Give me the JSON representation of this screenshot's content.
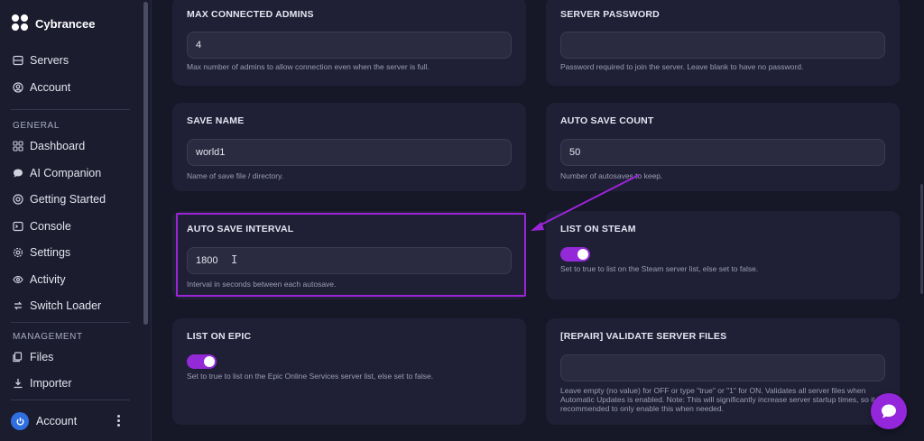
{
  "brand": {
    "name": "Cybrancee",
    "icon": "cybrancee-logo"
  },
  "sidebar": {
    "top_items": [
      {
        "label": "Servers",
        "icon": "server-icon"
      },
      {
        "label": "Account",
        "icon": "user-circle-icon"
      }
    ],
    "general_label": "GENERAL",
    "general_items": [
      {
        "label": "Dashboard",
        "icon": "grid-icon"
      },
      {
        "label": "AI Companion",
        "icon": "chat-icon"
      },
      {
        "label": "Getting Started",
        "icon": "lifebuoy-icon"
      },
      {
        "label": "Console",
        "icon": "terminal-icon"
      },
      {
        "label": "Settings",
        "icon": "gear-icon"
      },
      {
        "label": "Activity",
        "icon": "eye-icon"
      },
      {
        "label": "Switch Loader",
        "icon": "swap-icon"
      }
    ],
    "management_label": "MANAGEMENT",
    "management_items": [
      {
        "label": "Files",
        "icon": "files-icon"
      },
      {
        "label": "Importer",
        "icon": "download-icon"
      }
    ],
    "account_label": "Account"
  },
  "settings": {
    "max_connected_admins": {
      "title": "MAX CONNECTED ADMINS",
      "value": "4",
      "help": "Max number of admins to allow connection even when the server is full."
    },
    "server_password": {
      "title": "SERVER PASSWORD",
      "value": "",
      "help": "Password required to join the server. Leave blank to have no password."
    },
    "save_name": {
      "title": "SAVE NAME",
      "value": "world1",
      "help": "Name of save file / directory."
    },
    "auto_save_count": {
      "title": "AUTO SAVE COUNT",
      "value": "50",
      "help": "Number of autosaves to keep."
    },
    "auto_save_interval": {
      "title": "AUTO SAVE INTERVAL",
      "value": "1800",
      "help": "Interval in seconds between each autosave."
    },
    "list_on_steam": {
      "title": "LIST ON STEAM",
      "enabled": true,
      "help": "Set to true to list on the Steam server list, else set to false."
    },
    "list_on_epic": {
      "title": "LIST ON EPIC",
      "enabled": true,
      "help": "Set to true to list on the Epic Online Services server list, else set to false."
    },
    "validate_server_files": {
      "title": "[REPAIR] VALIDATE SERVER FILES",
      "value": "",
      "help": "Leave empty (no value) for OFF or type \"true\" or \"1\" for ON. Validates all server files when Automatic Updates is enabled. Note: This will significantly increase server startup times, so it is recommended to only enable this when needed."
    }
  },
  "colors": {
    "accent": "#9b25d6",
    "background": "#161727",
    "card": "#1f2035"
  }
}
